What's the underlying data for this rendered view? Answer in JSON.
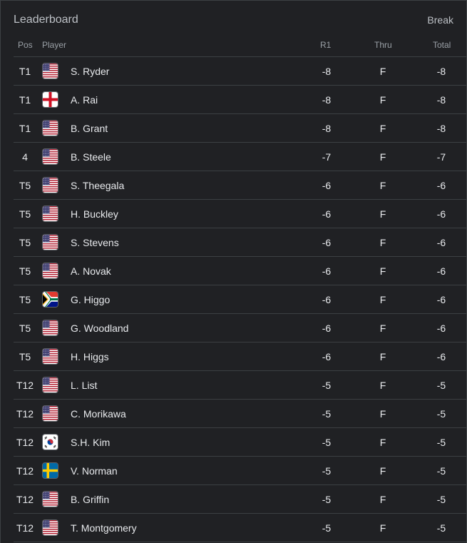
{
  "header": {
    "title": "Leaderboard",
    "break_label": "Break"
  },
  "columns": {
    "pos": "Pos",
    "player": "Player",
    "r1": "R1",
    "thru": "Thru",
    "total": "Total"
  },
  "rows": [
    {
      "pos": "T1",
      "flag": "usa",
      "name": "S. Ryder",
      "r1": "-8",
      "thru": "F",
      "total": "-8"
    },
    {
      "pos": "T1",
      "flag": "england",
      "name": "A. Rai",
      "r1": "-8",
      "thru": "F",
      "total": "-8"
    },
    {
      "pos": "T1",
      "flag": "usa",
      "name": "B. Grant",
      "r1": "-8",
      "thru": "F",
      "total": "-8"
    },
    {
      "pos": "4",
      "flag": "usa",
      "name": "B. Steele",
      "r1": "-7",
      "thru": "F",
      "total": "-7"
    },
    {
      "pos": "T5",
      "flag": "usa",
      "name": "S. Theegala",
      "r1": "-6",
      "thru": "F",
      "total": "-6"
    },
    {
      "pos": "T5",
      "flag": "usa",
      "name": "H. Buckley",
      "r1": "-6",
      "thru": "F",
      "total": "-6"
    },
    {
      "pos": "T5",
      "flag": "usa",
      "name": "S. Stevens",
      "r1": "-6",
      "thru": "F",
      "total": "-6"
    },
    {
      "pos": "T5",
      "flag": "usa",
      "name": "A. Novak",
      "r1": "-6",
      "thru": "F",
      "total": "-6"
    },
    {
      "pos": "T5",
      "flag": "south-africa",
      "name": "G. Higgo",
      "r1": "-6",
      "thru": "F",
      "total": "-6"
    },
    {
      "pos": "T5",
      "flag": "usa",
      "name": "G. Woodland",
      "r1": "-6",
      "thru": "F",
      "total": "-6"
    },
    {
      "pos": "T5",
      "flag": "usa",
      "name": "H. Higgs",
      "r1": "-6",
      "thru": "F",
      "total": "-6"
    },
    {
      "pos": "T12",
      "flag": "usa",
      "name": "L. List",
      "r1": "-5",
      "thru": "F",
      "total": "-5"
    },
    {
      "pos": "T12",
      "flag": "usa",
      "name": "C. Morikawa",
      "r1": "-5",
      "thru": "F",
      "total": "-5"
    },
    {
      "pos": "T12",
      "flag": "south-korea",
      "name": "S.H. Kim",
      "r1": "-5",
      "thru": "F",
      "total": "-5"
    },
    {
      "pos": "T12",
      "flag": "sweden",
      "name": "V. Norman",
      "r1": "-5",
      "thru": "F",
      "total": "-5"
    },
    {
      "pos": "T12",
      "flag": "usa",
      "name": "B. Griffin",
      "r1": "-5",
      "thru": "F",
      "total": "-5"
    },
    {
      "pos": "T12",
      "flag": "usa",
      "name": "T. Montgomery",
      "r1": "-5",
      "thru": "F",
      "total": "-5"
    }
  ]
}
